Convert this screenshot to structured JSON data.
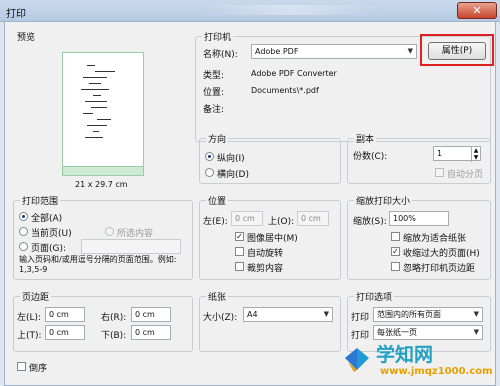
{
  "window": {
    "title": "打印",
    "close_glyph": "✕"
  },
  "preview": {
    "label": "预览",
    "size_text": "21 x 29.7 cm"
  },
  "printer": {
    "group_title": "打印机",
    "name_label": "名称(N):",
    "name_value": "Adobe PDF",
    "properties_button": "属性(P)",
    "type_label": "类型:",
    "type_value": "Adobe PDF Converter",
    "location_label": "位置:",
    "location_value": "Documents\\*.pdf",
    "comment_label": "备注:"
  },
  "direction": {
    "group_title": "方向",
    "portrait": "纵向(I)",
    "landscape": "横向(D)",
    "selected": "portrait"
  },
  "copies": {
    "group_title": "副本",
    "count_label": "份数(C):",
    "count_value": "1",
    "collate_label": "自动分页"
  },
  "print_range": {
    "group_title": "打印范围",
    "all": "全部(A)",
    "current_page": "当前页(U)",
    "selection": "所选内容",
    "pages": "页面(G):",
    "hint": "输入页码和/或用逗号分隔的页面范围。例如: 1,3,5-9"
  },
  "position": {
    "group_title": "位置",
    "left_label": "左(E):",
    "left_value": "0 cm",
    "top_label": "上(O):",
    "top_value": "0 cm",
    "center_image": "图像居中(M)",
    "auto_rotate": "自动旋转",
    "crop_content": "裁剪内容"
  },
  "scaling": {
    "group_title": "缩放打印大小",
    "scale_label": "缩放(S):",
    "scale_value": "100%",
    "fit_paper": "缩放为适合纸张",
    "shrink_oversized": "收缩过大的页面(H)",
    "ignore_margins": "忽略打印机页边距"
  },
  "margins": {
    "group_title": "页边距",
    "left_label": "左(L):",
    "left_value": "0 cm",
    "right_label": "右(R):",
    "right_value": "0 cm",
    "top_label": "上(T):",
    "top_value": "0 cm",
    "bottom_label": "下(B):",
    "bottom_value": "0 cm"
  },
  "paper": {
    "group_title": "纸张",
    "size_label": "大小(Z):",
    "size_value": "A4"
  },
  "print_options": {
    "group_title": "打印选项",
    "print_label": "打印",
    "print_value": "范围内的所有页面",
    "print2_label": "打印",
    "print2_value": "每张纸一页"
  },
  "reverse_order": "倒序",
  "watermark": {
    "title": "学知网",
    "url": "www.jmqz1000.com"
  },
  "colors": {
    "highlight": "#e02020",
    "accent": "#21a0c4",
    "url": "#e8a000"
  }
}
